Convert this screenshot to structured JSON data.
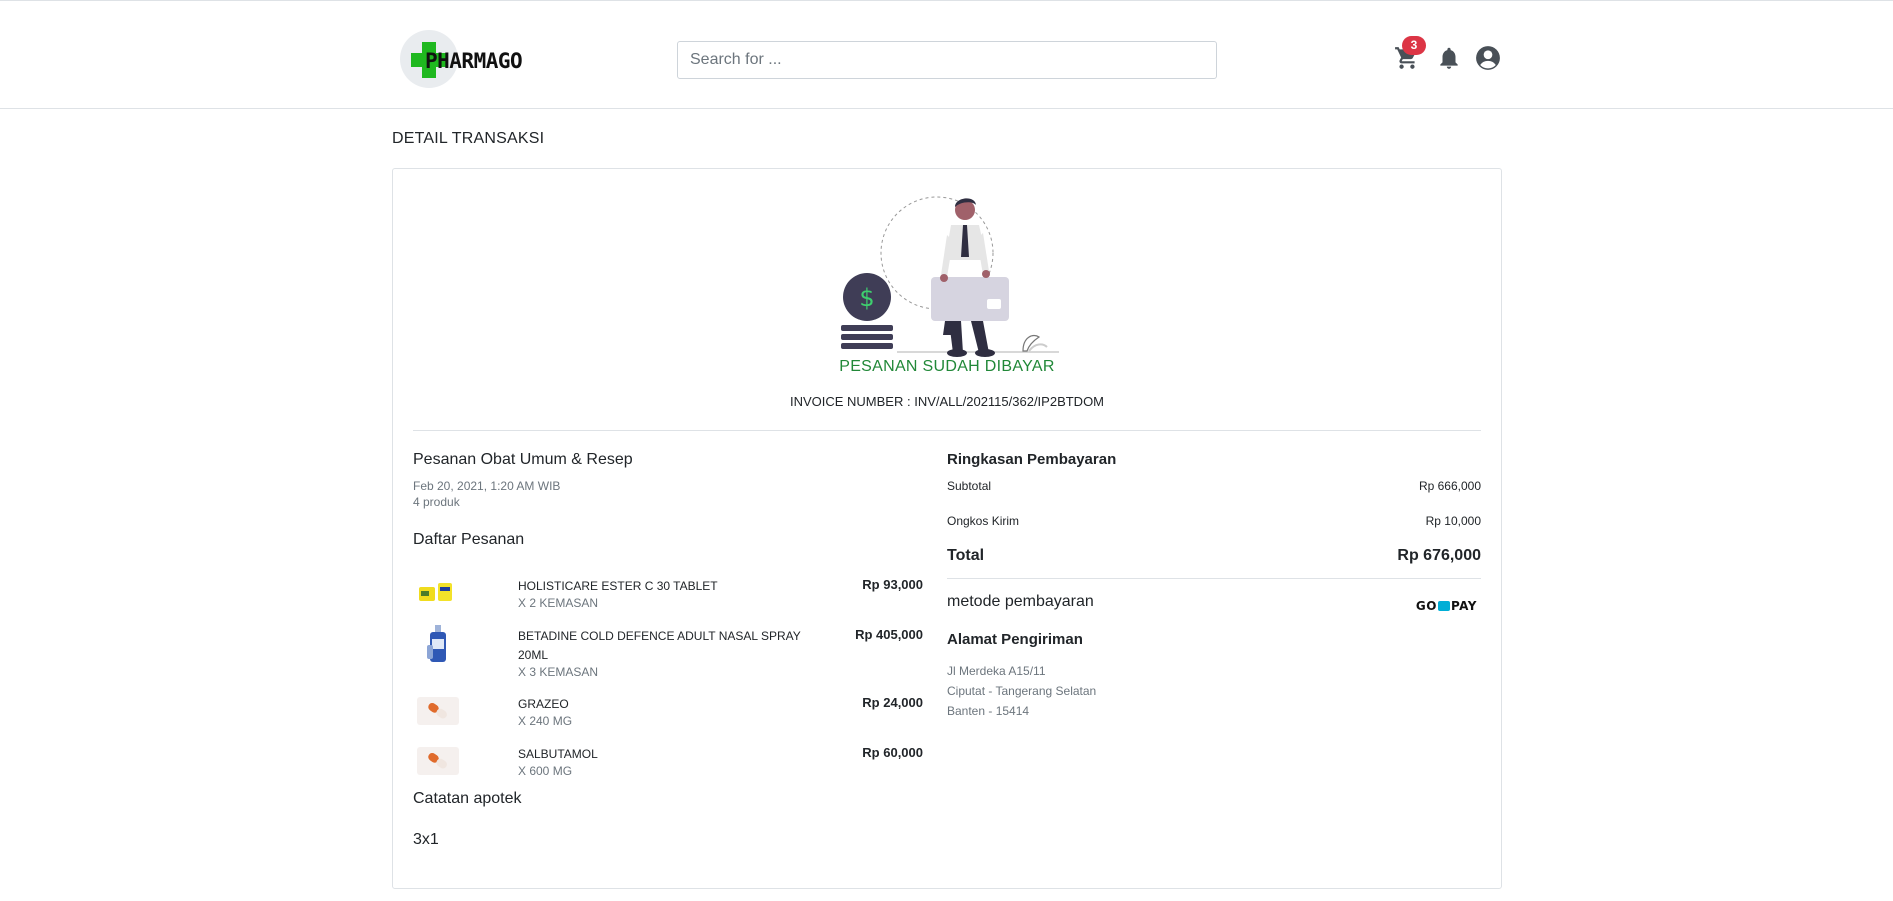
{
  "header": {
    "logo_text": "PHARMAGO",
    "search_placeholder": "Search for ...",
    "cart_count": "3",
    "icons": [
      "cart-icon",
      "bell-icon",
      "user-circle-icon"
    ]
  },
  "page": {
    "title": "DETAIL TRANSAKSI"
  },
  "status": {
    "label": "PESANAN SUDAH DIBAYAR",
    "color": "#218838",
    "invoice": "INVOICE NUMBER : INV/ALL/202115/362/IP2BTDOM"
  },
  "order": {
    "title": "Pesanan Obat Umum & Resep",
    "date": "Feb 20, 2021, 1:20 AM WIB",
    "count": "4 produk",
    "list_heading": "Daftar Pesanan",
    "items": [
      {
        "name": "HOLISTICARE ESTER C 30 TABLET",
        "qty": "x 2 kemasan",
        "price": "Rp 93,000",
        "image": "vitamin-box-image"
      },
      {
        "name": "BETADINE COLD DEFENCE ADULT NASAL SPRAY 20ML",
        "qty": "x 3 kemasan",
        "price": "Rp 405,000",
        "image": "nasal-spray-image"
      },
      {
        "name": "GRAZEO",
        "qty": "x 240 mg",
        "price": "Rp 24,000",
        "image": "capsule-image"
      },
      {
        "name": "SALBUTAMOL",
        "qty": "x 600 mg",
        "price": "Rp 60,000",
        "image": "capsule-image"
      }
    ],
    "notes_heading": "Catatan apotek",
    "notes": "3x1"
  },
  "summary": {
    "heading": "Ringkasan Pembayaran",
    "subtotal_label": "Subtotal",
    "subtotal": "Rp 666,000",
    "shipping_label": "Ongkos Kirim",
    "shipping": "Rp 10,000",
    "total_label": "Total",
    "total": "Rp 676,000",
    "payment_label": "metode pembayaran",
    "payment_method_left": "GO",
    "payment_method_right": "PAY"
  },
  "address": {
    "heading": "Alamat Pengiriman",
    "line1": "Jl Merdeka A15/11",
    "line2": "Ciputat - Tangerang Selatan",
    "line3": "Banten - 15414"
  }
}
